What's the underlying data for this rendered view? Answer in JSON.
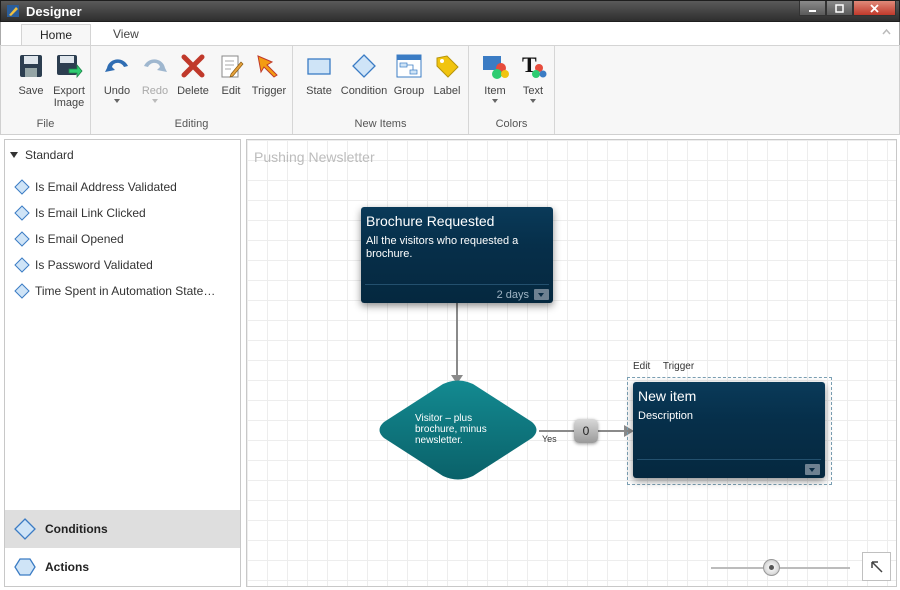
{
  "window": {
    "title": "Designer"
  },
  "tabs": [
    {
      "label": "Home"
    },
    {
      "label": "View"
    }
  ],
  "ribbon": {
    "groups": [
      {
        "label": "File",
        "buttons": [
          {
            "label": "Save"
          },
          {
            "label": "Export Image"
          }
        ]
      },
      {
        "label": "Editing",
        "buttons": [
          {
            "label": "Undo"
          },
          {
            "label": "Redo"
          },
          {
            "label": "Delete"
          },
          {
            "label": "Edit"
          },
          {
            "label": "Trigger"
          }
        ]
      },
      {
        "label": "New Items",
        "buttons": [
          {
            "label": "State"
          },
          {
            "label": "Condition"
          },
          {
            "label": "Group"
          },
          {
            "label": "Label"
          }
        ]
      },
      {
        "label": "Colors",
        "buttons": [
          {
            "label": "Item"
          },
          {
            "label": "Text"
          }
        ]
      }
    ]
  },
  "left_panel": {
    "section": "Standard",
    "items": [
      "Is Email Address Validated",
      "Is Email Link Clicked",
      "Is Email Opened",
      "Is Password Validated",
      "Time Spent in Automation State…"
    ],
    "bottom": [
      {
        "label": "Conditions"
      },
      {
        "label": "Actions"
      }
    ]
  },
  "canvas": {
    "title": "Pushing Newsletter",
    "state1": {
      "title": "Brochure Requested",
      "description": "All the visitors who requested a brochure.",
      "duration": "2 days"
    },
    "condition": {
      "text": "Visitor – plus brochure, minus newsletter.",
      "yes_label": "Yes",
      "count": "0"
    },
    "state2": {
      "actions": [
        "Edit",
        "Trigger"
      ],
      "title": "New item",
      "description": "Description"
    }
  },
  "colors": {
    "state_bg": "#062f4a",
    "condition_bg": "#0b6f76",
    "ribbon_bg": "#f7f7f7"
  }
}
